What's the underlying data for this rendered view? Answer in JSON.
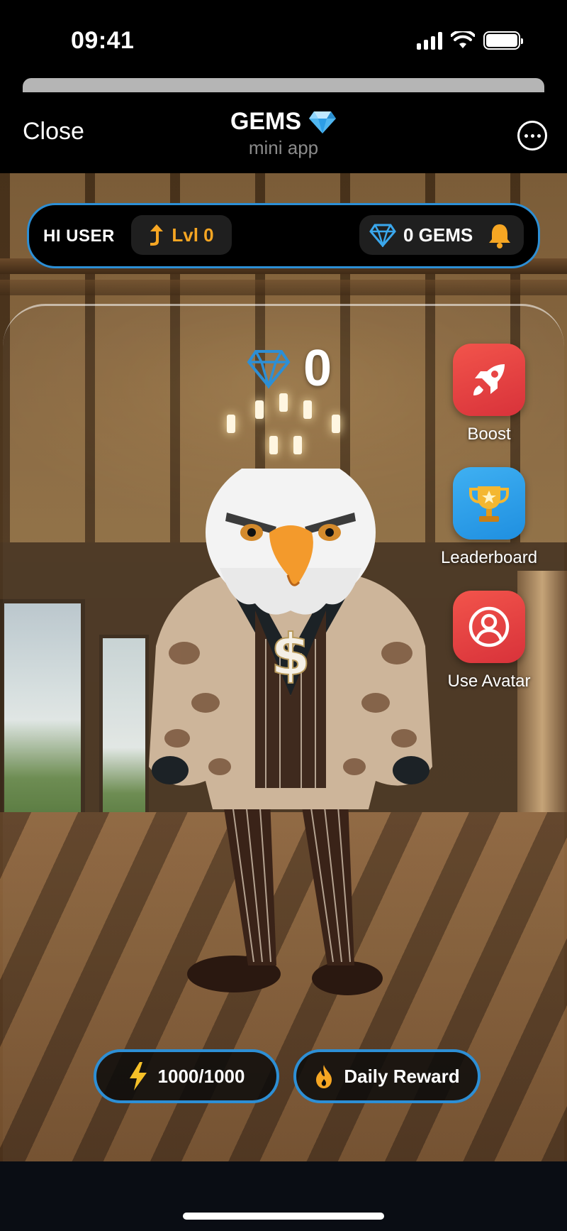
{
  "status_bar": {
    "time": "09:41"
  },
  "header": {
    "close_label": "Close",
    "title": "GEMS",
    "subtitle": "mini app"
  },
  "info_bar": {
    "greeting": "HI USER",
    "level": "Lvl 0",
    "gems": "0 GEMS"
  },
  "balance": {
    "value": "0"
  },
  "side_actions": [
    {
      "label": "Boost",
      "icon": "rocket-icon",
      "color": "#e84545"
    },
    {
      "label": "Leaderboard",
      "icon": "trophy-icon",
      "color": "#2a9ae6"
    },
    {
      "label": "Use Avatar",
      "icon": "user-circle-icon",
      "color": "#e84545"
    }
  ],
  "bottom": {
    "energy": "1000/1000",
    "daily_reward": "Daily Reward"
  },
  "colors": {
    "accent_blue": "#2d8fd5",
    "level_orange": "#f6a623",
    "bell_yellow": "#f6a623"
  }
}
